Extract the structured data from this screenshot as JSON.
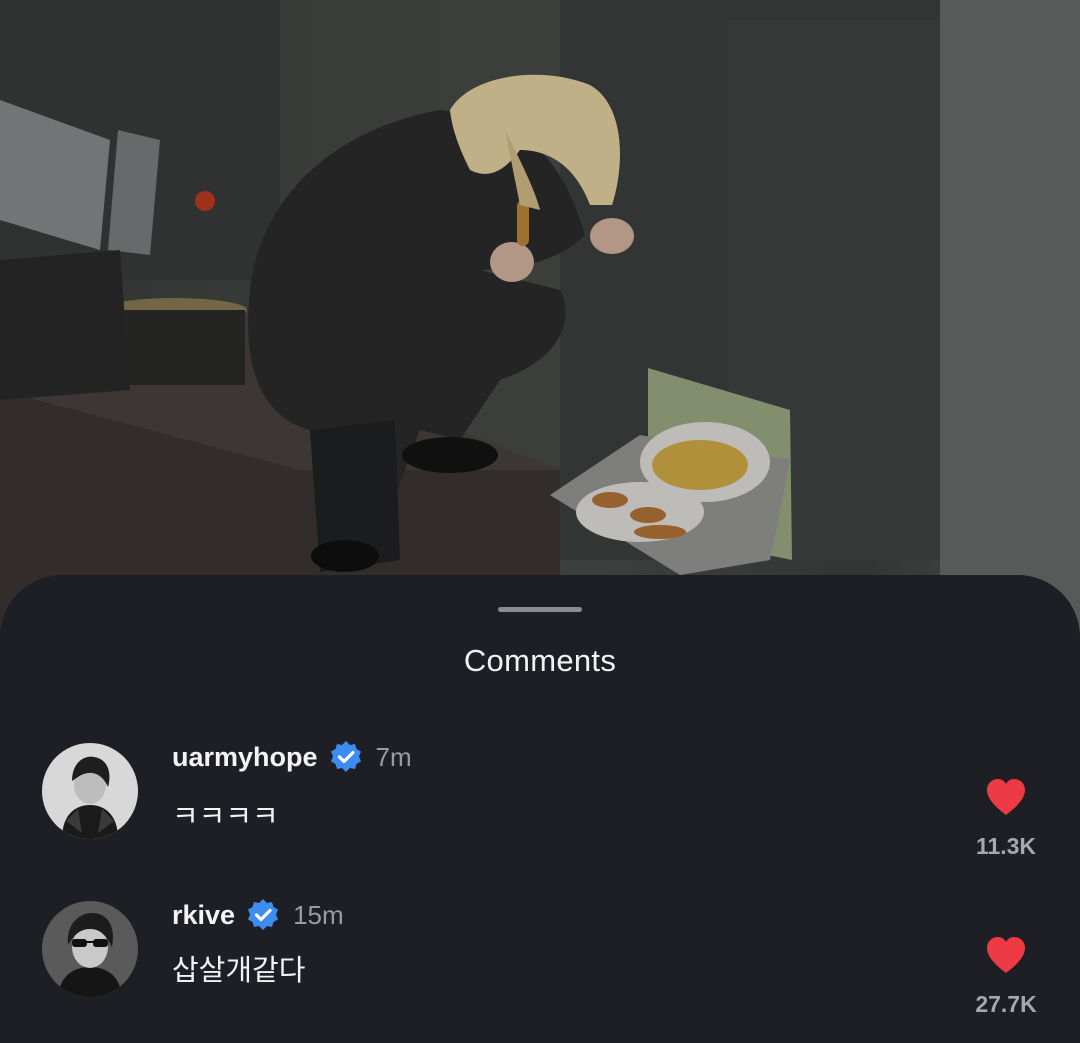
{
  "sheet": {
    "title": "Comments"
  },
  "comments": [
    {
      "username": "uarmyhope",
      "verified": true,
      "time": "7m",
      "text": "ㅋㅋㅋㅋ",
      "likes": "11.3K"
    },
    {
      "username": "rkive",
      "verified": true,
      "time": "15m",
      "text": "삽살개같다",
      "likes": "27.7K"
    }
  ],
  "icons": {
    "verified": "verified-badge-icon",
    "like": "heart-icon"
  },
  "colors": {
    "sheet_background": "#1e1f24",
    "verified_blue": "#3d8cf0",
    "heart_red": "#ee3a45",
    "muted_text": "#9a9ba2"
  }
}
